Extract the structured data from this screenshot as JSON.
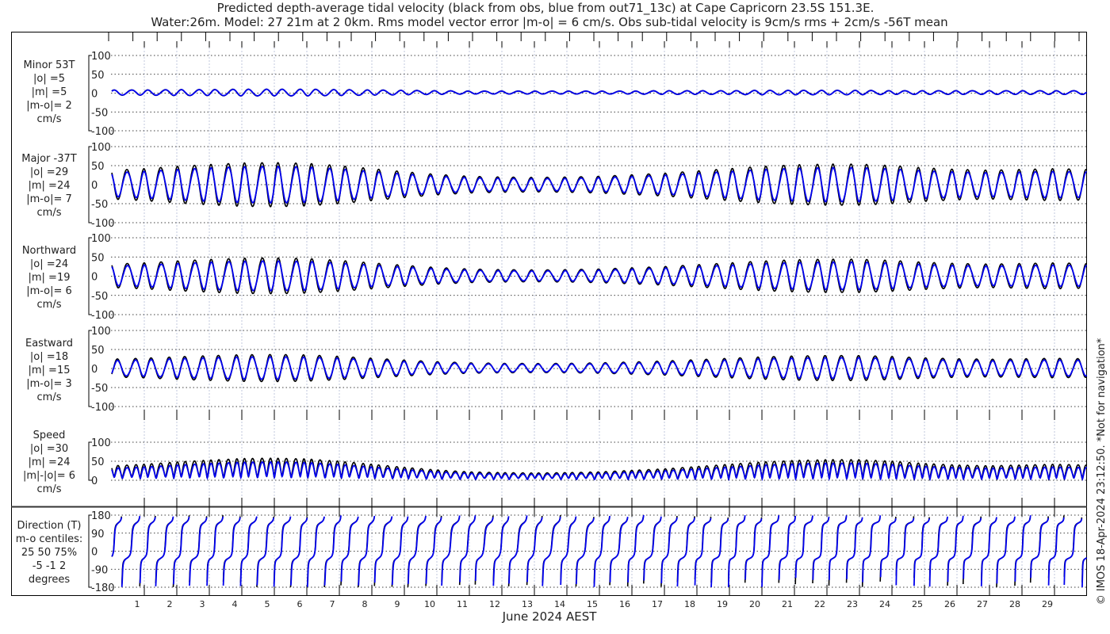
{
  "chart_data": {
    "type": "line",
    "title": "Predicted depth-average tidal velocity (black from obs, blue from out71_13c) at Cape Capricorn 23.5S 151.3E.",
    "subtitle": "Water:26m. Model: 27 21m at 2 0km. Rms model vector error |m-o| = 6 cm/s. Obs sub-tidal velocity is 9cm/s rms + 2cm/s -56T mean",
    "xlabel": "June 2024 AEST",
    "x_range_days": [
      0,
      30
    ],
    "x_ticks": [
      "1",
      "2",
      "3",
      "4",
      "5",
      "6",
      "7",
      "8",
      "9",
      "10",
      "11",
      "12",
      "13",
      "14",
      "15",
      "16",
      "17",
      "18",
      "19",
      "20",
      "21",
      "22",
      "23",
      "24",
      "25",
      "26",
      "27",
      "28",
      "29"
    ],
    "series_legend": {
      "obs": "black",
      "model": "blue"
    },
    "colors": {
      "obs": "#000000",
      "model": "#0000ee",
      "grid": "#9aa3c8"
    },
    "tidal_frequency_cycles_per_day": 1.9323,
    "major_amplitude_by_day_obs": [
      38,
      42,
      48,
      53,
      57,
      58,
      56,
      50,
      42,
      34,
      27,
      22,
      20,
      19,
      20,
      22,
      26,
      30,
      36,
      42,
      48,
      52,
      54,
      54,
      50,
      44,
      40,
      38,
      40,
      42,
      40
    ],
    "minor_amplitude_by_day_obs": [
      7,
      7,
      8,
      8,
      9,
      9,
      9,
      8,
      7,
      6,
      5,
      4,
      4,
      4,
      4,
      4,
      4,
      5,
      5,
      5,
      6,
      6,
      6,
      6,
      5,
      5,
      5,
      5,
      5,
      5,
      5
    ],
    "model_ratio": 0.83,
    "panels": [
      {
        "id": "minor",
        "lines": [
          "Minor 53T",
          "|o| =5",
          "|m| =5",
          "|m-o|= 2",
          "cm/s"
        ],
        "ylim": [
          -100,
          100
        ],
        "yticks": [
          "100",
          "50",
          "0",
          "-50",
          "-100"
        ]
      },
      {
        "id": "major",
        "lines": [
          "Major -37T",
          "|o| =29",
          "|m| =24",
          "|m-o|= 7",
          "cm/s"
        ],
        "ylim": [
          -100,
          100
        ],
        "yticks": [
          "100",
          "50",
          "0",
          "-50",
          "-100"
        ]
      },
      {
        "id": "north",
        "lines": [
          "Northward",
          "|o| =24",
          "|m| =19",
          "|m-o|= 6",
          "cm/s"
        ],
        "ylim": [
          -100,
          100
        ],
        "yticks": [
          "100",
          "50",
          "0",
          "-50",
          "-100"
        ]
      },
      {
        "id": "east",
        "lines": [
          "Eastward",
          "|o| =18",
          "|m| =15",
          "|m-o|= 3",
          "cm/s"
        ],
        "ylim": [
          -100,
          100
        ],
        "yticks": [
          "100",
          "50",
          "0",
          "-50",
          "-100"
        ]
      },
      {
        "id": "speed",
        "lines": [
          "Speed",
          "|o| =30",
          "|m| =24",
          "|m|-|o|= 6",
          "cm/s"
        ],
        "ylim": [
          0,
          100
        ],
        "yticks": [
          "100",
          "50",
          "0"
        ]
      },
      {
        "id": "dir",
        "lines": [
          "Direction (T)",
          "m-o centiles:",
          "25  50  75%",
          "-5 -1  2",
          "degrees"
        ],
        "ylim": [
          -180,
          180
        ],
        "yticks": [
          "180",
          "90",
          "0",
          "-90",
          "-180"
        ]
      }
    ]
  },
  "footer": {
    "copyright": "© IMOS 18-Apr-2024 23:12:50. *Not for navigation*"
  }
}
